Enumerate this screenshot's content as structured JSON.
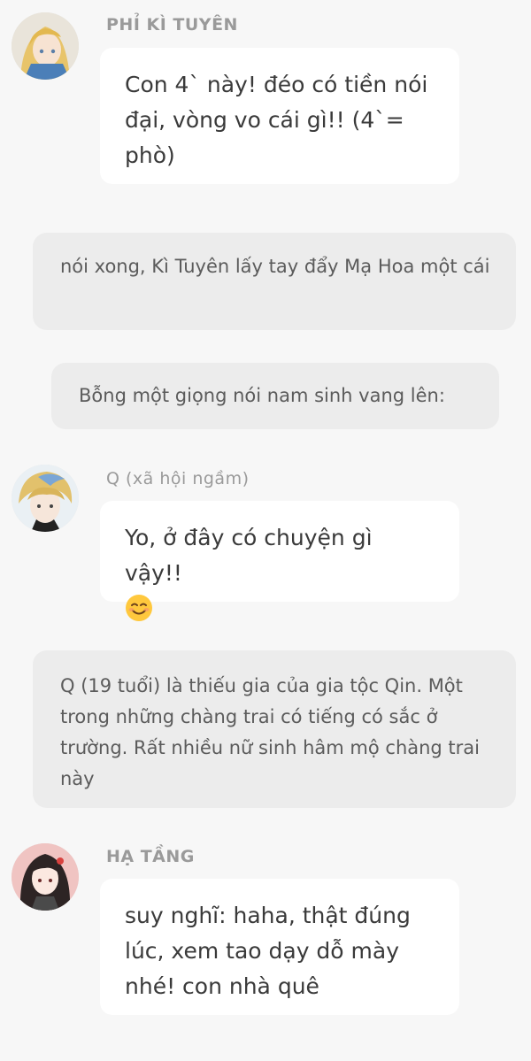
{
  "messages": [
    {
      "speaker": "PHỈ KÌ TUYÊN",
      "text": "Con 4` này! đéo có tiền nói đại, vòng vo cái gì!! (4`= phò)"
    },
    {
      "narration": "nói xong, Kì Tuyên lấy tay đẩy Mạ Hoa một cái"
    },
    {
      "narration": "Bỗng một giọng nói nam sinh vang lên:"
    },
    {
      "speaker": "Q (xã hội ngầm)",
      "text": "Yo, ở đây có chuyện gì vậy!!",
      "emoji": "smiling-face-emoji"
    },
    {
      "narration": "Q (19 tuổi) là thiếu gia của gia tộc Qin. Một trong những chàng trai có tiếng có sắc ở trường. Rất nhiều nữ sinh hâm mộ chàng trai này"
    },
    {
      "speaker": "HẠ TẦNG",
      "text": "suy nghĩ: haha, thật đúng lúc, xem tao dạy dỗ mày nhé! con nhà quê"
    }
  ],
  "colors": {
    "background": "#f7f7f7",
    "bubble": "#ffffff",
    "narration": "#ececec",
    "speaker": "#9a9a9a",
    "text": "#3a3a3a"
  }
}
